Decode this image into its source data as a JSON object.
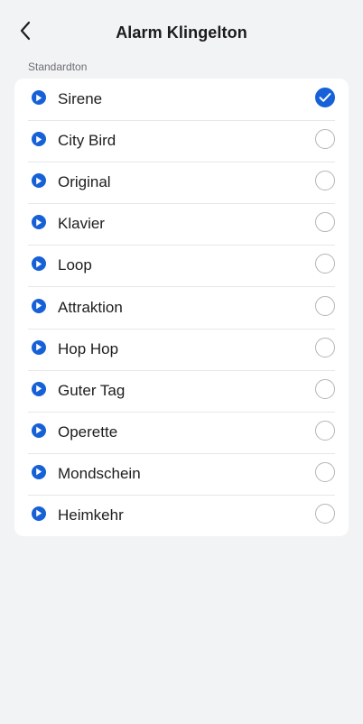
{
  "header": {
    "title": "Alarm Klingelton"
  },
  "section": {
    "label": "Standardton"
  },
  "colors": {
    "accent": "#1660d8",
    "background": "#f2f3f5",
    "card": "#ffffff"
  },
  "ringtones": [
    {
      "label": "Sirene",
      "selected": true
    },
    {
      "label": "City Bird",
      "selected": false
    },
    {
      "label": "Original",
      "selected": false
    },
    {
      "label": "Klavier",
      "selected": false
    },
    {
      "label": "Loop",
      "selected": false
    },
    {
      "label": "Attraktion",
      "selected": false
    },
    {
      "label": "Hop Hop",
      "selected": false
    },
    {
      "label": "Guter Tag",
      "selected": false
    },
    {
      "label": "Operette",
      "selected": false
    },
    {
      "label": "Mondschein",
      "selected": false
    },
    {
      "label": "Heimkehr",
      "selected": false
    }
  ]
}
